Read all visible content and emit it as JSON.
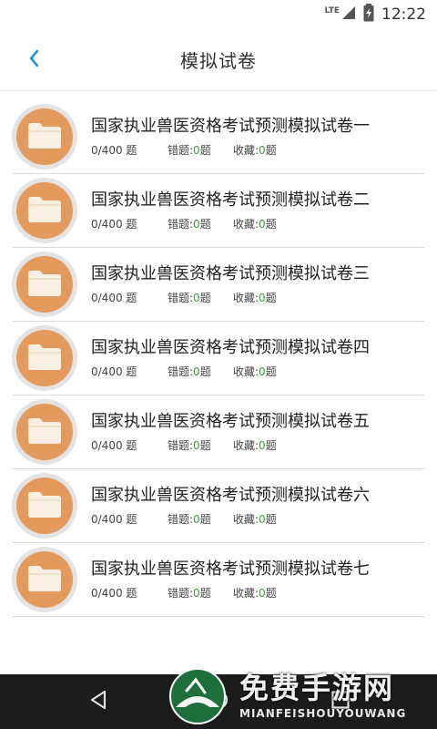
{
  "status_bar": {
    "network": "LTE",
    "time": "12:22"
  },
  "header": {
    "title": "模拟试卷"
  },
  "list": {
    "wrong_label": "错题:",
    "fav_label": "收藏:",
    "unit": "题",
    "items": [
      {
        "title": "国家执业兽医资格考试预测模拟试卷一",
        "progress": "0/400 题",
        "wrong": "0",
        "fav": "0"
      },
      {
        "title": "国家执业兽医资格考试预测模拟试卷二",
        "progress": "0/400 题",
        "wrong": "0",
        "fav": "0"
      },
      {
        "title": "国家执业兽医资格考试预测模拟试卷三",
        "progress": "0/400 题",
        "wrong": "0",
        "fav": "0"
      },
      {
        "title": "国家执业兽医资格考试预测模拟试卷四",
        "progress": "0/400 题",
        "wrong": "0",
        "fav": "0"
      },
      {
        "title": "国家执业兽医资格考试预测模拟试卷五",
        "progress": "0/400 题",
        "wrong": "0",
        "fav": "0"
      },
      {
        "title": "国家执业兽医资格考试预测模拟试卷六",
        "progress": "0/400 题",
        "wrong": "0",
        "fav": "0"
      },
      {
        "title": "国家执业兽医资格考试预测模拟试卷七",
        "progress": "0/400 题",
        "wrong": "0",
        "fav": "0"
      }
    ]
  },
  "watermark": {
    "title": "免费手游网",
    "subtitle": "MIANFEISHOUYOUWANG"
  },
  "colors": {
    "accent": "#1e88e5",
    "folder_bg": "#e39a5c",
    "count_green": "#3aa03a",
    "nav_bar": "#1c1c1c"
  },
  "icons": {
    "back": "chevron-left-icon",
    "folder": "folder-icon",
    "nav_back": "triangle-back-icon",
    "nav_home": "circle-home-icon",
    "nav_recent": "square-recent-icon"
  }
}
